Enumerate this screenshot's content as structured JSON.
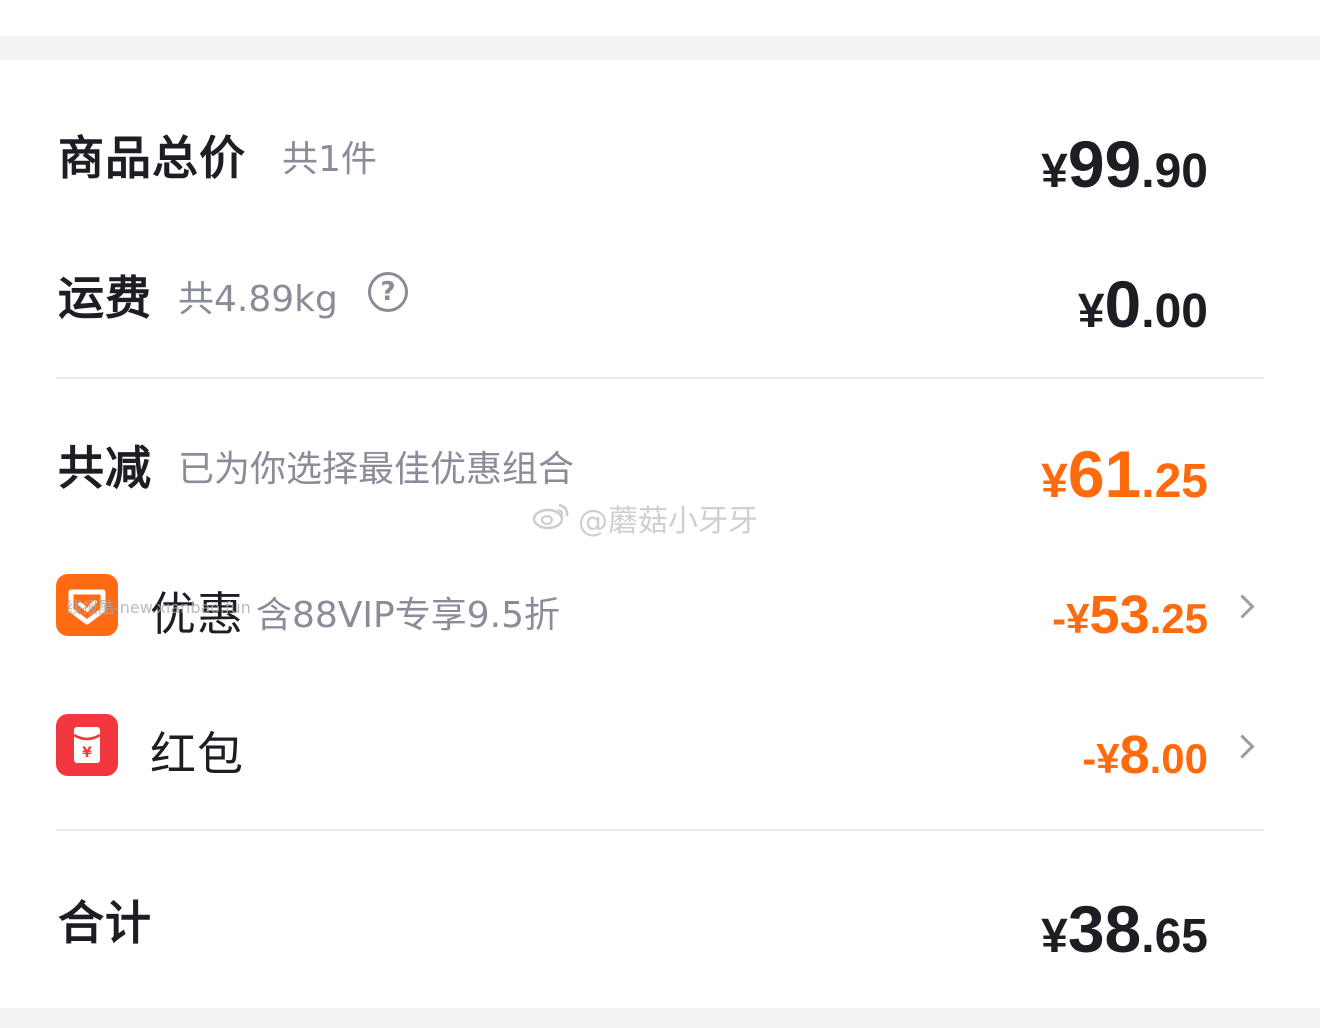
{
  "summary": {
    "goods_total": {
      "label": "商品总价",
      "sub": "共1件",
      "currency": "¥",
      "int": "99",
      "dec": ".90"
    },
    "shipping": {
      "label": "运费",
      "sub": "共4.89kg",
      "help_glyph": "?",
      "currency": "¥",
      "int": "0",
      "dec": ".00"
    },
    "total_reduction": {
      "label": "共减",
      "sub": "已为你选择最佳优惠组合",
      "currency": "¥",
      "int": "61",
      "dec": ".25",
      "color": "#ff6a0d"
    },
    "discount": {
      "icon": "discount-tag-icon",
      "label": "优惠",
      "sub": "含88VIP专享9.5折",
      "currency": "-¥",
      "int": "53",
      "dec": ".25"
    },
    "red_packet": {
      "icon": "red-packet-icon",
      "label": "红包",
      "currency": "-¥",
      "int": "8",
      "dec": ".00"
    },
    "grand_total": {
      "label": "合计",
      "currency": "¥",
      "int": "38",
      "dec": ".65"
    }
  },
  "watermarks": {
    "weibo": "@蘑菇小牙牙",
    "site": "线报酷-new.xianbao.fun"
  },
  "colors": {
    "accent_orange": "#ff6a0d",
    "discount_icon": "#ff6a12",
    "red_packet_icon": "#f2383e",
    "text_primary": "#1d1d24",
    "text_secondary": "#8a8d99"
  }
}
